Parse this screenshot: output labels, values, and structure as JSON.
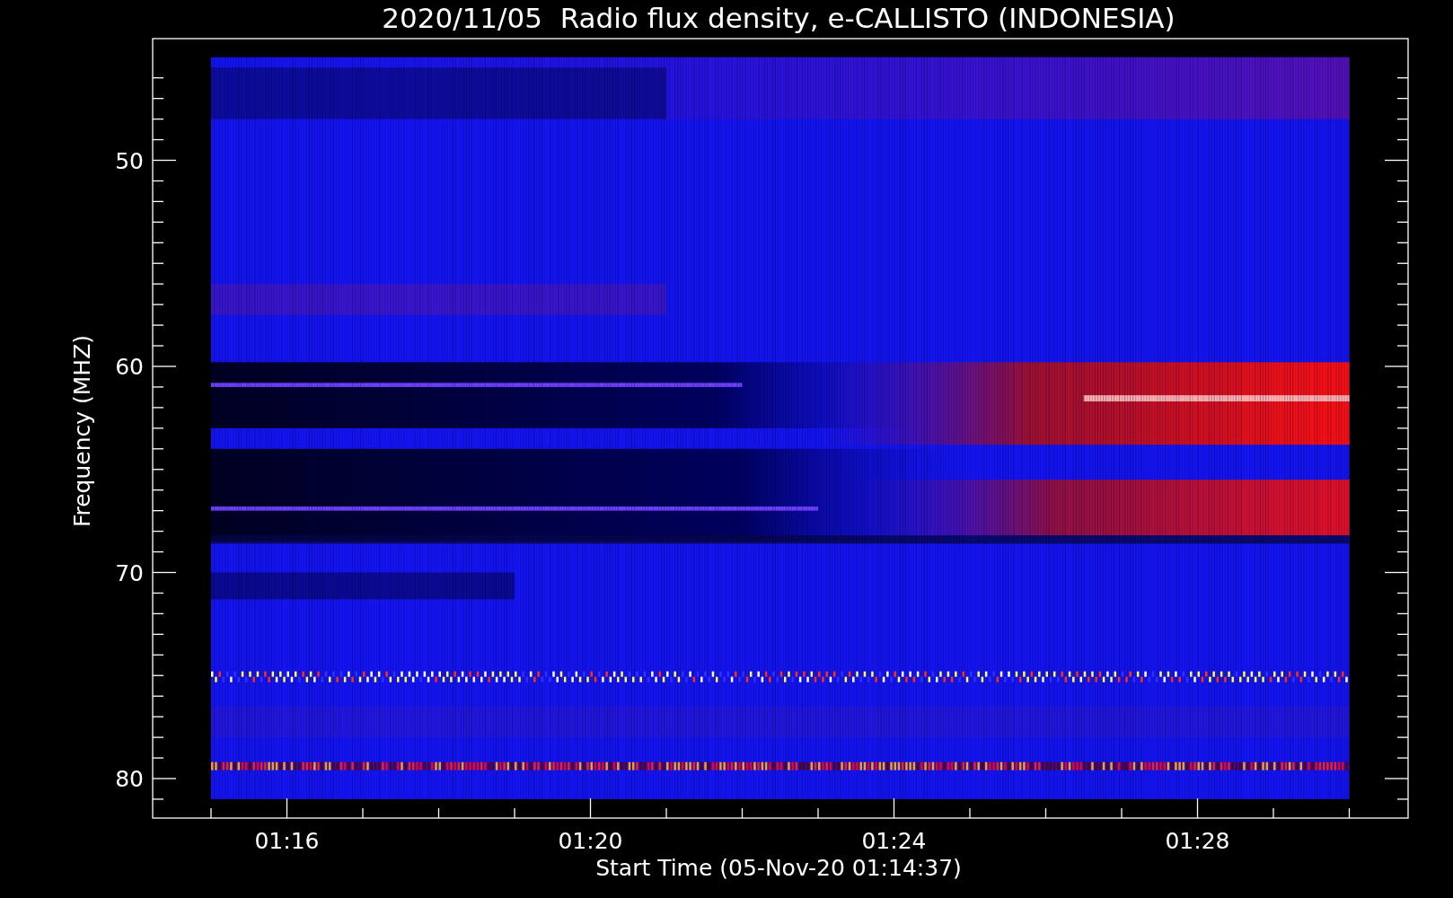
{
  "title": "2020/11/05  Radio flux density, e-CALLISTO (INDONESIA)",
  "y_axis": {
    "label": "Frequency (MHZ)",
    "ticks": [
      "50",
      "60",
      "70",
      "80"
    ]
  },
  "x_axis": {
    "label": "Start Time (05-Nov-20 01:14:37)",
    "ticks": [
      "01:16",
      "01:20",
      "01:24",
      "01:28"
    ]
  }
}
